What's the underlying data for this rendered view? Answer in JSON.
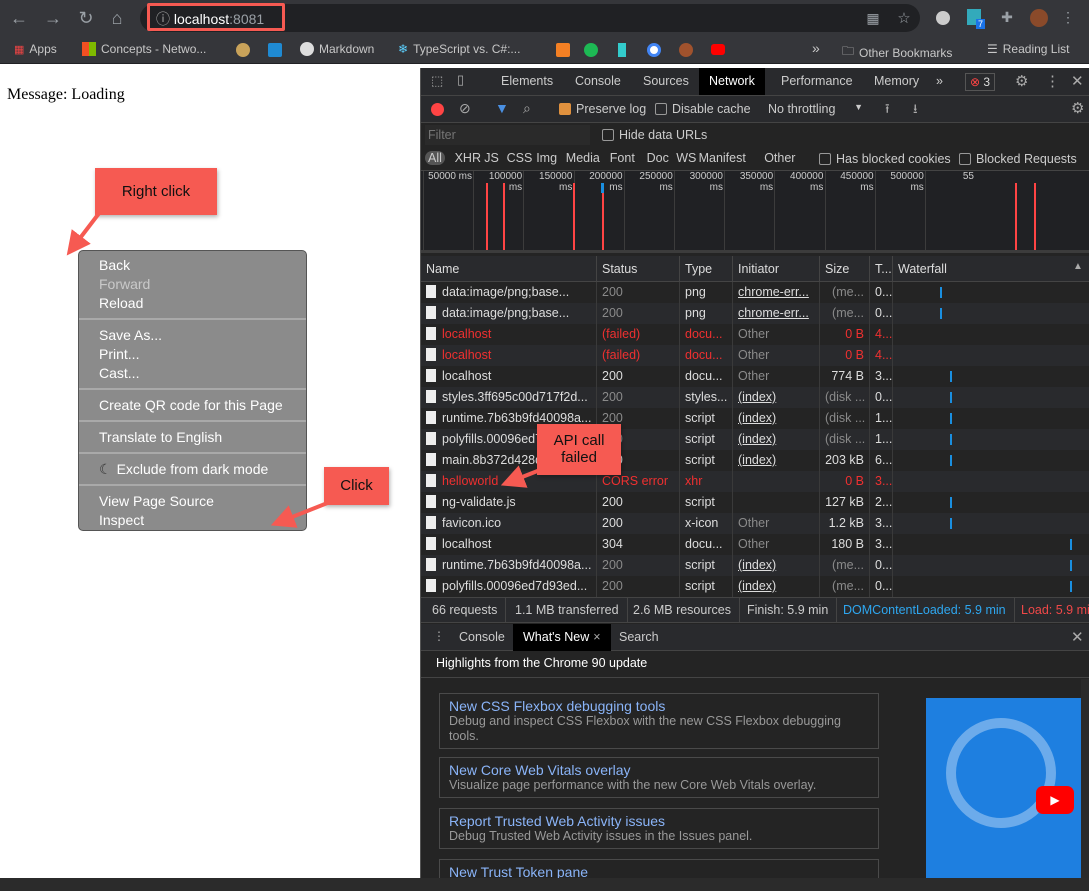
{
  "browser": {
    "url_host": "localhost",
    "url_port": ":8081",
    "avatar_badge": "7",
    "bookmarks": [
      "Apps",
      "Concepts - Netwo...",
      "",
      "",
      "Markdown",
      "TypeScript vs. C#:...",
      "",
      "",
      "",
      "",
      "",
      ""
    ],
    "bookmarks_more": "»",
    "other_bookmarks": "Other Bookmarks",
    "reading_list": "Reading List"
  },
  "page": {
    "message": "Message: Loading"
  },
  "context_menu": {
    "groups": [
      [
        "Back",
        "Forward",
        "Reload"
      ],
      [
        "Save As...",
        "Print...",
        "Cast..."
      ],
      [
        "Create QR code for this Page"
      ],
      [
        "Translate to English"
      ],
      [
        "Exclude from dark mode"
      ],
      [
        "View Page Source",
        "Inspect"
      ]
    ],
    "disabled": [
      "Forward"
    ]
  },
  "annotations": {
    "right_click": "Right click",
    "click": "Click",
    "api_call": "API call failed",
    "color": "#f65a52"
  },
  "devtools": {
    "tabs": [
      "Elements",
      "Console",
      "Sources",
      "Network",
      "Performance",
      "Memory"
    ],
    "active_tab": "Network",
    "more": "»",
    "error_count": "3",
    "toolbar": {
      "preserve_log": "Preserve log",
      "preserve_log_checked": true,
      "disable_cache": "Disable cache",
      "throttling": "No throttling"
    },
    "filter": {
      "placeholder": "Filter",
      "hide_data_urls": "Hide data URLs",
      "types": [
        "All",
        "XHR",
        "JS",
        "CSS",
        "Img",
        "Media",
        "Font",
        "Doc",
        "WS",
        "Manifest",
        "Other"
      ],
      "has_blocked_cookies": "Has blocked cookies",
      "blocked_requests": "Blocked Requests"
    },
    "timeline_ticks": [
      "50000 ms",
      "100000 ms",
      "150000 ms",
      "200000 ms",
      "250000 ms",
      "300000 ms",
      "350000 ms",
      "400000 ms",
      "450000 ms",
      "500000 ms",
      "55"
    ],
    "columns": [
      "Name",
      "Status",
      "Type",
      "Initiator",
      "Size",
      "T...",
      "Waterfall"
    ],
    "rows": [
      {
        "name": "data:image/png;base...",
        "status": "200",
        "type": "png",
        "initiator": "chrome-err...",
        "size": "(me...",
        "time": "0...",
        "state": "dim"
      },
      {
        "name": "data:image/png;base...",
        "status": "200",
        "type": "png",
        "initiator": "chrome-err...",
        "size": "(me...",
        "time": "0...",
        "state": "dim"
      },
      {
        "name": "localhost",
        "status": "(failed)",
        "type": "docu...",
        "initiator": "Other",
        "size": "0 B",
        "time": "4...",
        "state": "error"
      },
      {
        "name": "localhost",
        "status": "(failed)",
        "type": "docu...",
        "initiator": "Other",
        "size": "0 B",
        "time": "4...",
        "state": "error"
      },
      {
        "name": "localhost",
        "status": "200",
        "type": "docu...",
        "initiator": "Other",
        "size": "774 B",
        "time": "3...",
        "state": "ok"
      },
      {
        "name": "styles.3ff695c00d717f2d...",
        "status": "200",
        "type": "styles...",
        "initiator": "(index)",
        "size": "(disk ...",
        "time": "0...",
        "state": "dim"
      },
      {
        "name": "runtime.7b63b9fd40098a...",
        "status": "200",
        "type": "script",
        "initiator": "(index)",
        "size": "(disk ...",
        "time": "1...",
        "state": "dim"
      },
      {
        "name": "polyfills.00096ed7d93ed...",
        "status": "200",
        "type": "script",
        "initiator": "(index)",
        "size": "(disk ...",
        "time": "1...",
        "state": "dim"
      },
      {
        "name": "main.8b372d428d...",
        "status": "200",
        "type": "script",
        "initiator": "(index)",
        "size": "203 kB",
        "time": "6...",
        "state": "ok"
      },
      {
        "name": "helloworld",
        "status": "CORS error",
        "type": "xhr",
        "initiator": "",
        "size": "0 B",
        "time": "3...",
        "state": "error"
      },
      {
        "name": "ng-validate.js",
        "status": "200",
        "type": "script",
        "initiator": "",
        "size": "127 kB",
        "time": "2...",
        "state": "ok"
      },
      {
        "name": "favicon.ico",
        "status": "200",
        "type": "x-icon",
        "initiator": "Other",
        "size": "1.2 kB",
        "time": "3...",
        "state": "ok"
      },
      {
        "name": "localhost",
        "status": "304",
        "type": "docu...",
        "initiator": "Other",
        "size": "180 B",
        "time": "3...",
        "state": "ok"
      },
      {
        "name": "runtime.7b63b9fd40098a...",
        "status": "200",
        "type": "script",
        "initiator": "(index)",
        "size": "(me...",
        "time": "0...",
        "state": "dim"
      },
      {
        "name": "polyfills.00096ed7d93ed...",
        "status": "200",
        "type": "script",
        "initiator": "(index)",
        "size": "(me...",
        "time": "0...",
        "state": "dim"
      }
    ],
    "summary": {
      "requests": "66 requests",
      "transferred": "1.1 MB transferred",
      "resources": "2.6 MB resources",
      "finish": "Finish: 5.9 min",
      "dcl": "DOMContentLoaded: 5.9 min",
      "load": "Load: 5.9 min"
    },
    "drawer": {
      "tabs": [
        "Console",
        "What's New",
        "Search"
      ],
      "active": "What's New",
      "heading": "Highlights from the Chrome 90 update",
      "cards": [
        {
          "title": "New CSS Flexbox debugging tools",
          "desc": "Debug and inspect CSS Flexbox with the new CSS Flexbox debugging tools."
        },
        {
          "title": "New Core Web Vitals overlay",
          "desc": "Visualize page performance with the new Core Web Vitals overlay."
        },
        {
          "title": "Report Trusted Web Activity issues",
          "desc": "Debug Trusted Web Activity issues in the Issues panel."
        },
        {
          "title": "New Trust Token pane",
          "desc": ""
        }
      ]
    }
  }
}
